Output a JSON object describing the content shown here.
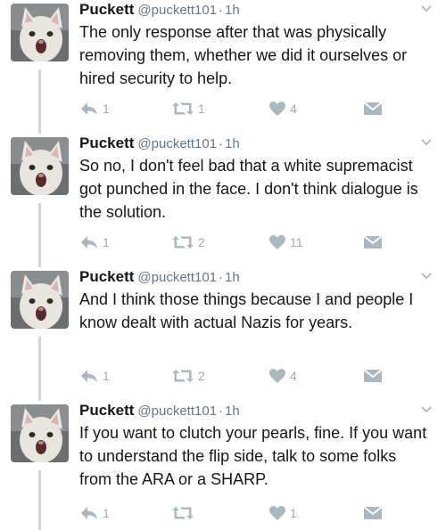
{
  "tweets": [
    {
      "name": "Puckett",
      "handle": "@puckett101",
      "separator": "·",
      "time": "1h",
      "text": "The only response after that was physically removing them, whether we did it ourselves or hired security to help.",
      "reply_count": "1",
      "retweet_count": "1",
      "like_count": "4"
    },
    {
      "name": "Puckett",
      "handle": "@puckett101",
      "separator": "·",
      "time": "1h",
      "text": "So no, I don't feel bad that a white supremacist got punched in the face. I don't think dialogue is the solution.",
      "reply_count": "1",
      "retweet_count": "2",
      "like_count": "11"
    },
    {
      "name": "Puckett",
      "handle": "@puckett101",
      "separator": "·",
      "time": "1h",
      "text": "And I think those things because I and people I know dealt with actual Nazis for years.",
      "reply_count": "1",
      "retweet_count": "2",
      "like_count": "4"
    },
    {
      "name": "Puckett",
      "handle": "@puckett101",
      "separator": "·",
      "time": "1h",
      "text": "If you want to clutch your pearls, fine. If you want to understand the flip side, talk to some folks from the ARA or a SHARP.",
      "reply_count": "1",
      "retweet_count": "",
      "like_count": "1"
    }
  ],
  "icons": {
    "reply": "reply-icon",
    "retweet": "retweet-icon",
    "like": "heart-icon",
    "dm": "envelope-icon",
    "menu": "chevron-down-icon",
    "avatar": "cat-avatar"
  },
  "colors": {
    "text": "#14171a",
    "muted": "#657786",
    "icon": "#aab8c2",
    "thread_line": "#ccd6dd"
  }
}
